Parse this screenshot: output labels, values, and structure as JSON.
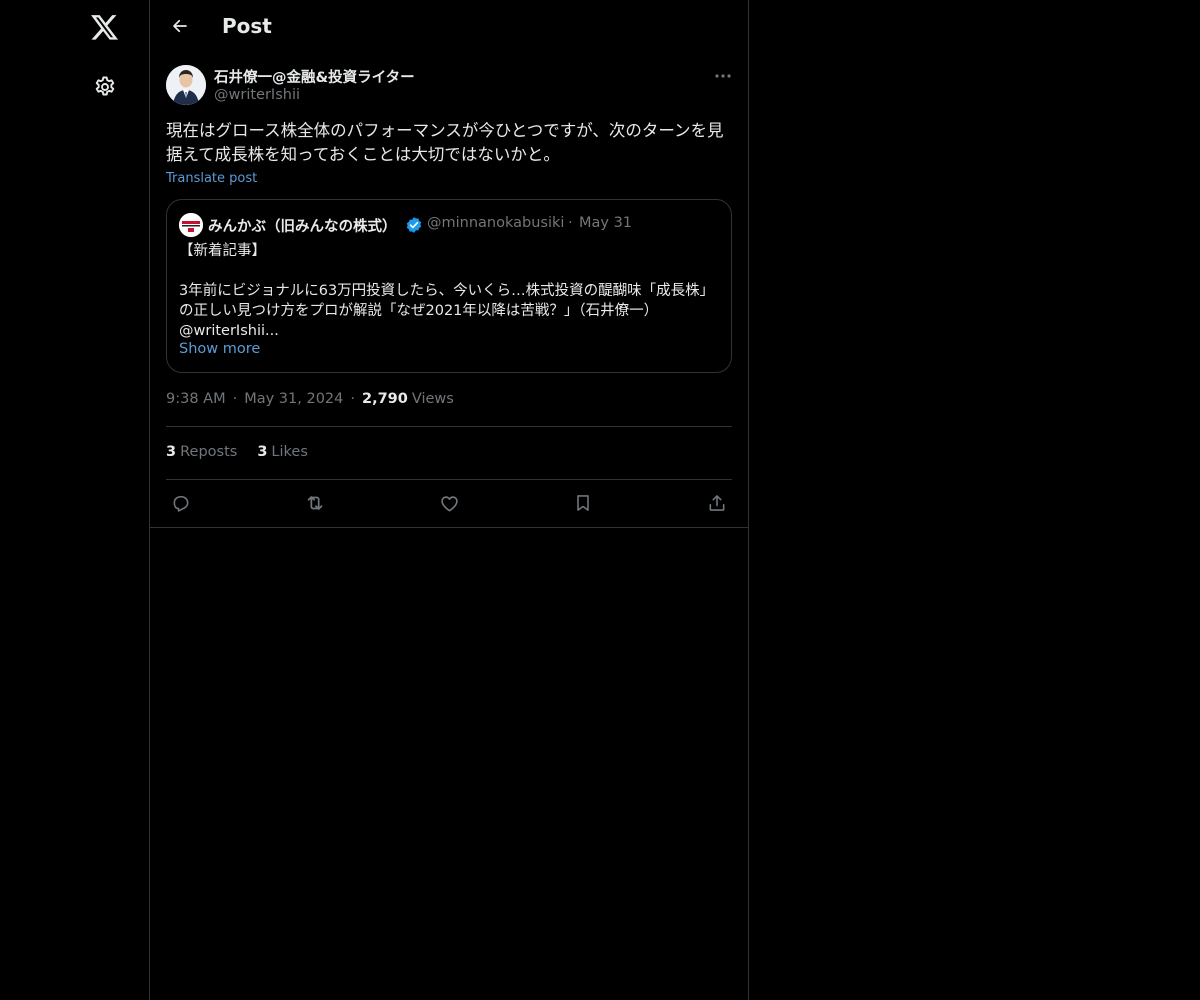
{
  "nav": {
    "logo_icon": "x-logo-icon",
    "settings_icon": "gear-icon"
  },
  "header": {
    "title": "Post",
    "back_icon": "arrow-left-icon"
  },
  "post": {
    "author_name": "石井僚一@金融&投資ライター",
    "author_handle": "@writerIshii",
    "text": "現在はグロース株全体のパフォーマンスが今ひとつですが、次のターンを見据えて成長株を知っておくことは大切ではないかと。",
    "translate_label": "Translate post",
    "time": "9:38 AM",
    "date": "May 31, 2024",
    "views_count": "2,790",
    "views_label": "Views"
  },
  "quote": {
    "name": "みんかぶ（旧みんなの株式）",
    "handle": "@minnanokabusiki",
    "date": "May 31",
    "text": "【新着記事】\n\n3年前にビジョナルに63万円投資したら、今いくら…株式投資の醍醐味「成長株」の正しい見つけ方をプロが解説「なぜ2021年以降は苦戦？」（石井僚一）@writerIshii...",
    "show_more": "Show more",
    "verified_color": "#1d9bf0"
  },
  "stats": {
    "reposts_count": "3",
    "reposts_label": "Reposts",
    "likes_count": "3",
    "likes_label": "Likes"
  },
  "actions": [
    {
      "icon": "reply-icon"
    },
    {
      "icon": "repost-icon"
    },
    {
      "icon": "like-icon"
    },
    {
      "icon": "bookmark-icon"
    },
    {
      "icon": "share-icon"
    }
  ],
  "colors": {
    "background": "#000000",
    "text": "#e7e9ea",
    "secondary": "#71767b",
    "link": "#5c9bd6",
    "border": "#2f3336"
  }
}
